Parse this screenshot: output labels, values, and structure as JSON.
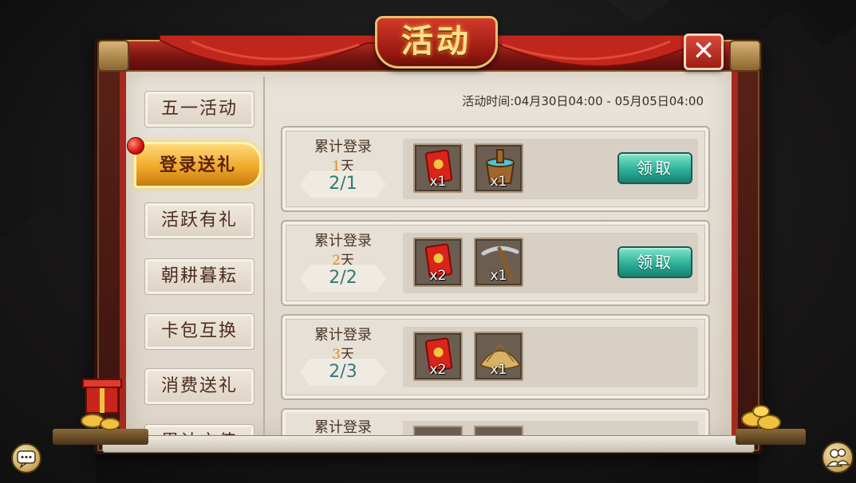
{
  "title": "活动",
  "activity_time": "活动时间:04月30日04:00 - 05月05日04:00",
  "tabs": [
    {
      "label": "五一活动"
    },
    {
      "label": "登录送礼",
      "active": true
    },
    {
      "label": "活跃有礼"
    },
    {
      "label": "朝耕暮耘"
    },
    {
      "label": "卡包互换"
    },
    {
      "label": "消费送礼"
    },
    {
      "label": "累计充值"
    }
  ],
  "rewards": [
    {
      "label": "累计登录",
      "day": "1",
      "day_unit": "天",
      "progress": "2/1",
      "items": [
        {
          "icon": "red-envelope-icon",
          "qty": "x1"
        },
        {
          "icon": "bucket-icon",
          "qty": "x1"
        }
      ],
      "button": "领取"
    },
    {
      "label": "累计登录",
      "day": "2",
      "day_unit": "天",
      "progress": "2/2",
      "items": [
        {
          "icon": "red-envelope-icon",
          "qty": "x2"
        },
        {
          "icon": "pickaxe-icon",
          "qty": "x1"
        }
      ],
      "button": "领取"
    },
    {
      "label": "累计登录",
      "day": "3",
      "day_unit": "天",
      "progress": "2/3",
      "items": [
        {
          "icon": "red-envelope-icon",
          "qty": "x2"
        },
        {
          "icon": "straw-hat-icon",
          "qty": "x1"
        }
      ]
    },
    {
      "label": "累计登录"
    }
  ],
  "colors": {
    "accent_gold": "#f0a92a",
    "claim_teal": "#2db09a",
    "progress_teal": "#2f7a7a",
    "day_orange": "#e48a1a",
    "banner_red": "#b43026"
  }
}
